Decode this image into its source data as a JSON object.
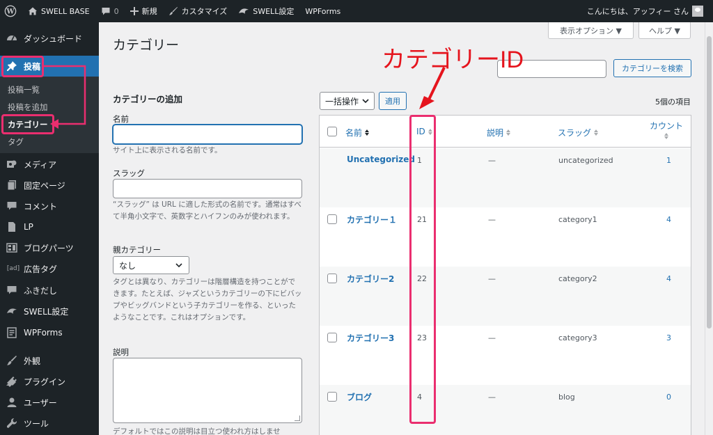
{
  "adminbar": {
    "site_name": "SWELL BASE",
    "comments_count": "0",
    "new_label": "新規",
    "customize_label": "カスタマイズ",
    "swell_settings_label": "SWELL設定",
    "wpforms_label": "WPForms",
    "greeting": "こんにちは、アッフィー さん"
  },
  "sidebar": {
    "items": [
      {
        "label": "ダッシュボード",
        "icon": "dashboard-icon"
      },
      {
        "label": "投稿",
        "icon": "pin-icon"
      },
      {
        "label": "メディア",
        "icon": "media-icon"
      },
      {
        "label": "固定ページ",
        "icon": "page-icon"
      },
      {
        "label": "コメント",
        "icon": "comment-icon"
      },
      {
        "label": "LP",
        "icon": "document-icon"
      },
      {
        "label": "ブログパーツ",
        "icon": "grid-icon"
      },
      {
        "label": "広告タグ",
        "icon": "ad-icon"
      },
      {
        "label": "ふきだし",
        "icon": "bubble-icon"
      },
      {
        "label": "SWELL設定",
        "icon": "swell-icon"
      },
      {
        "label": "WPForms",
        "icon": "form-icon"
      },
      {
        "label": "外観",
        "icon": "brush-icon"
      },
      {
        "label": "プラグイン",
        "icon": "plug-icon"
      },
      {
        "label": "ユーザー",
        "icon": "user-icon"
      },
      {
        "label": "ツール",
        "icon": "wrench-icon"
      }
    ],
    "submenu": [
      "投稿一覧",
      "投稿を追加",
      "カテゴリー",
      "タグ"
    ],
    "ad_glyph": "[ad]"
  },
  "screen_options_label": "表示オプション ▼",
  "help_label": "ヘルプ ▼",
  "page_title": "カテゴリー",
  "add_form": {
    "heading": "カテゴリーの追加",
    "name_label": "名前",
    "name_help": "サイト上に表示される名前です。",
    "slug_label": "スラッグ",
    "slug_help": "“スラッグ” は URL に適した形式の名前です。通常はすべて半角小文字で、英数字とハイフンのみが使われます。",
    "parent_label": "親カテゴリー",
    "parent_value": "なし",
    "parent_help": "タグとは異なり、カテゴリーは階層構造を持つことができます。たとえば、ジャズというカテゴリーの下にビバップやビッグバンドという子カテゴリーを作る、といったようなことです。これはオプションです。",
    "description_label": "説明",
    "description_help": "デフォルトではこの説明は目立つ使われ方はしませ"
  },
  "search_button": "カテゴリーを検索",
  "bulk_action": "一括操作",
  "apply_button": "適用",
  "items_count": "5個の項目",
  "table": {
    "headers": {
      "name": "名前",
      "id": "ID",
      "description": "説明",
      "slug": "スラッグ",
      "count": "カウント"
    },
    "rows": [
      {
        "name": "Uncategorized",
        "id": "1",
        "description": "—",
        "slug": "uncategorized",
        "count": "1"
      },
      {
        "name": "カテゴリー１",
        "id": "21",
        "description": "—",
        "slug": "category1",
        "count": "4"
      },
      {
        "name": "カテゴリー2",
        "id": "22",
        "description": "—",
        "slug": "category2",
        "count": "4"
      },
      {
        "name": "カテゴリー3",
        "id": "23",
        "description": "—",
        "slug": "category3",
        "count": "3"
      },
      {
        "name": "ブログ",
        "id": "4",
        "description": "—",
        "slug": "blog",
        "count": "0"
      }
    ]
  },
  "annotation": {
    "label": "カテゴリーID",
    "color": "#e5141d",
    "box_color": "#ea2e6f"
  }
}
